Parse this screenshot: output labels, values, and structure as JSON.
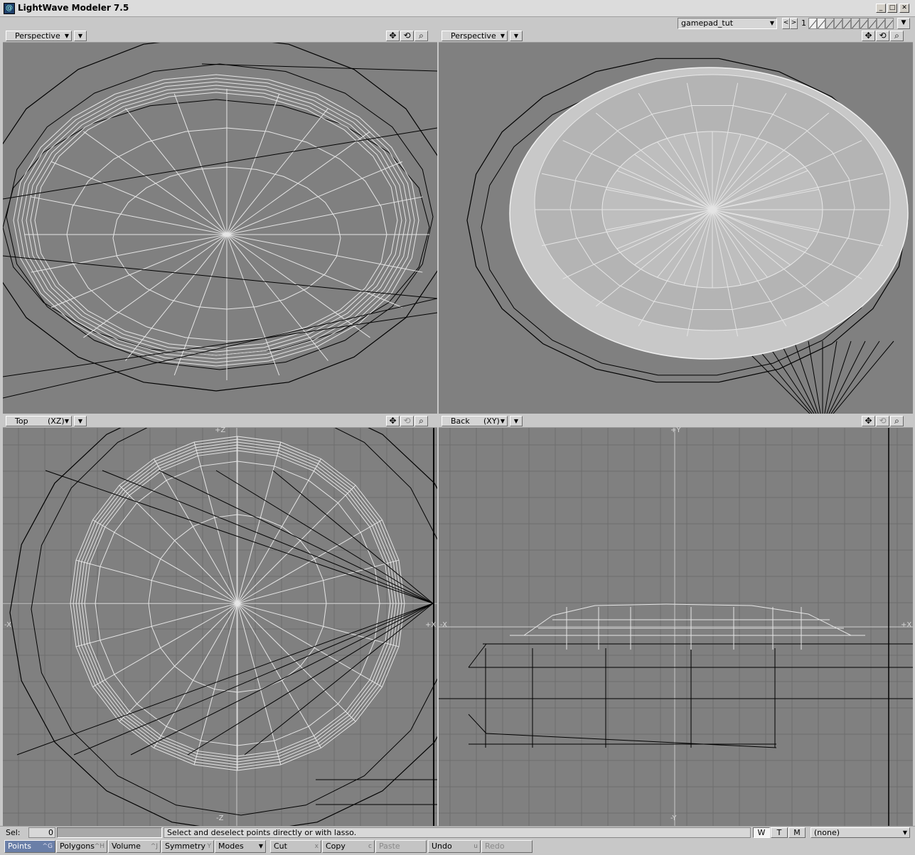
{
  "window": {
    "title": "LightWave Modeler 7.5",
    "app_icon": "lightwave-logo-icon",
    "minimize": "_",
    "maximize": "□",
    "close": "✕"
  },
  "topbar": {
    "scene": "gamepad_tut",
    "layer_number": "1",
    "prev": "<",
    "next": ">"
  },
  "viewports": [
    {
      "type": "Perspective",
      "axis": ""
    },
    {
      "type": "Perspective",
      "axis": ""
    },
    {
      "type": "Top",
      "axis": "(XZ)",
      "labels": {
        "top": "+Z",
        "bottom": "-Z",
        "left": "-X",
        "right": "+X"
      }
    },
    {
      "type": "Back",
      "axis": "(XY)",
      "labels": {
        "top": "+Y",
        "bottom": "-Y",
        "left": "-X",
        "right": "+X"
      }
    }
  ],
  "status": {
    "sel_label": "Sel:",
    "sel_count": "0",
    "hint": "Select and deselect points directly or with lasso.",
    "mode_w": "W",
    "mode_t": "T",
    "mode_m": "M",
    "surface": "(none)"
  },
  "toolbar": {
    "points": "Points",
    "points_key": "^G",
    "polygons": "Polygons",
    "polygons_key": "^H",
    "volume": "Volume",
    "volume_key": "^J",
    "symmetry": "Symmetry",
    "symmetry_key": "Y",
    "modes": "Modes",
    "cut": "Cut",
    "cut_key": "x",
    "copy": "Copy",
    "copy_key": "c",
    "paste": "Paste",
    "undo": "Undo",
    "undo_key": "u",
    "redo": "Redo"
  },
  "colors": {
    "viewport_bg": "#808080",
    "wire_black": "#000000",
    "wire_white": "#e8e8e8",
    "grid": "#6e6e6e",
    "active_mode": "#6a7fa8"
  }
}
